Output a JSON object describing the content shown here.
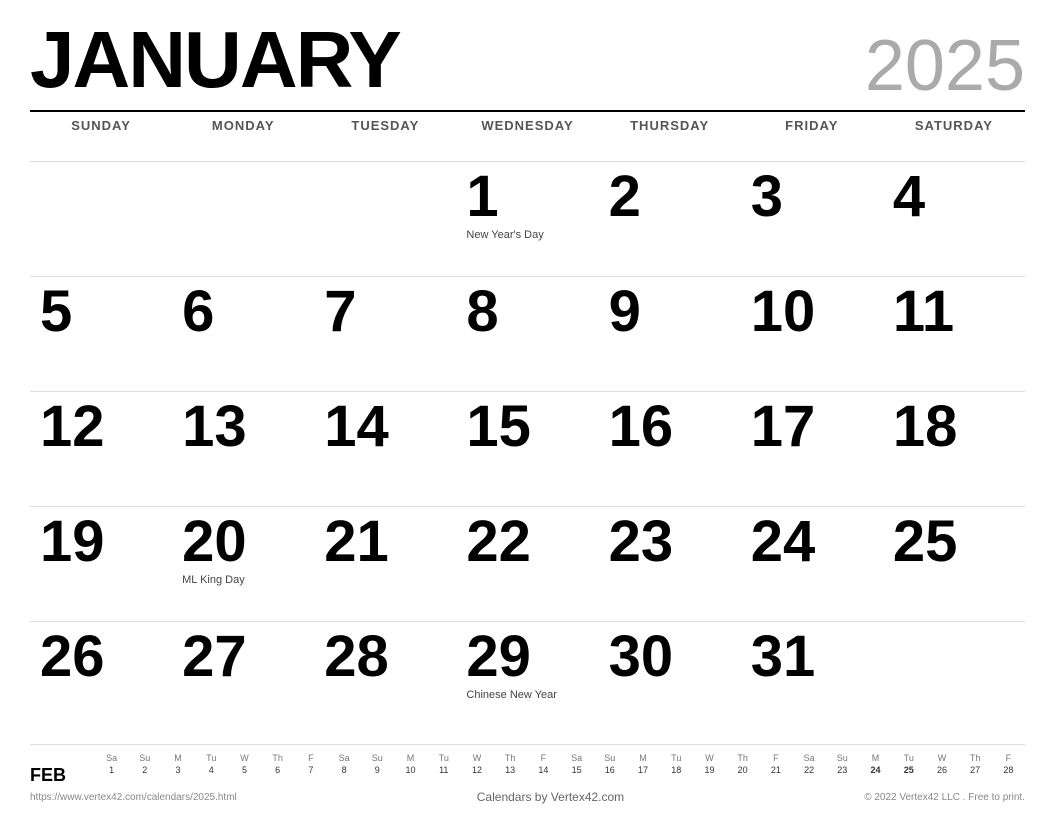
{
  "header": {
    "month": "JANUARY",
    "year": "2025"
  },
  "day_headers": [
    "SUNDAY",
    "MONDAY",
    "TUESDAY",
    "WEDNESDAY",
    "THURSDAY",
    "FRIDAY",
    "SATURDAY"
  ],
  "weeks": [
    [
      {
        "day": "",
        "holiday": ""
      },
      {
        "day": "",
        "holiday": ""
      },
      {
        "day": "",
        "holiday": ""
      },
      {
        "day": "1",
        "holiday": "New Year's Day"
      },
      {
        "day": "2",
        "holiday": ""
      },
      {
        "day": "3",
        "holiday": ""
      },
      {
        "day": "4",
        "holiday": ""
      }
    ],
    [
      {
        "day": "5",
        "holiday": ""
      },
      {
        "day": "6",
        "holiday": ""
      },
      {
        "day": "7",
        "holiday": ""
      },
      {
        "day": "8",
        "holiday": ""
      },
      {
        "day": "9",
        "holiday": ""
      },
      {
        "day": "10",
        "holiday": ""
      },
      {
        "day": "11",
        "holiday": ""
      }
    ],
    [
      {
        "day": "12",
        "holiday": ""
      },
      {
        "day": "13",
        "holiday": ""
      },
      {
        "day": "14",
        "holiday": ""
      },
      {
        "day": "15",
        "holiday": ""
      },
      {
        "day": "16",
        "holiday": ""
      },
      {
        "day": "17",
        "holiday": ""
      },
      {
        "day": "18",
        "holiday": ""
      }
    ],
    [
      {
        "day": "19",
        "holiday": ""
      },
      {
        "day": "20",
        "holiday": "ML King Day"
      },
      {
        "day": "21",
        "holiday": ""
      },
      {
        "day": "22",
        "holiday": ""
      },
      {
        "day": "23",
        "holiday": ""
      },
      {
        "day": "24",
        "holiday": ""
      },
      {
        "day": "25",
        "holiday": ""
      }
    ],
    [
      {
        "day": "26",
        "holiday": ""
      },
      {
        "day": "27",
        "holiday": ""
      },
      {
        "day": "28",
        "holiday": ""
      },
      {
        "day": "29",
        "holiday": "Chinese New Year"
      },
      {
        "day": "30",
        "holiday": ""
      },
      {
        "day": "31",
        "holiday": ""
      },
      {
        "day": "",
        "holiday": ""
      }
    ]
  ],
  "mini_calendar": {
    "label": "FEB",
    "col_headers": [
      "Sa",
      "Su",
      "M",
      "Tu",
      "W",
      "Th",
      "F",
      "Sa",
      "Su",
      "M",
      "Tu",
      "W",
      "Th",
      "F",
      "Sa",
      "Su",
      "M",
      "Tu",
      "W",
      "Th",
      "F",
      "Sa",
      "Su",
      "M",
      "Tu",
      "W",
      "Th",
      "F"
    ],
    "col_numbers": [
      "1",
      "2",
      "3",
      "4",
      "5",
      "6",
      "7",
      "8",
      "9",
      "10",
      "11",
      "12",
      "13",
      "14",
      "15",
      "16",
      "17",
      "18",
      "19",
      "20",
      "21",
      "22",
      "23",
      "24",
      "25",
      "26",
      "27",
      "28"
    ],
    "bold_days": [
      "24",
      "25"
    ]
  },
  "footer": {
    "left": "https://www.vertex42.com/calendars/2025.html",
    "center": "Calendars by Vertex42.com",
    "right": "© 2022 Vertex42 LLC . Free to print."
  }
}
